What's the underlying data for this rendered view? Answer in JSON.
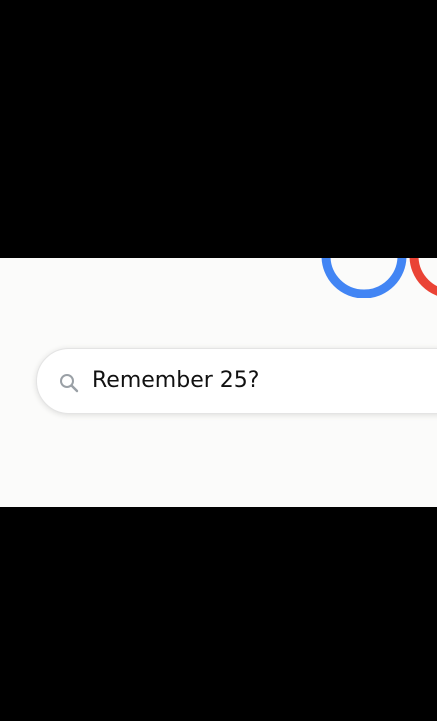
{
  "search": {
    "query": "Remember 25?",
    "icon": "search-icon"
  },
  "logo": {
    "colors": {
      "blue": "#4285F4",
      "red": "#EA4335"
    }
  },
  "colors": {
    "letterbox": "#000000",
    "page_background": "#fbfbfa",
    "search_box_background": "#ffffff"
  }
}
